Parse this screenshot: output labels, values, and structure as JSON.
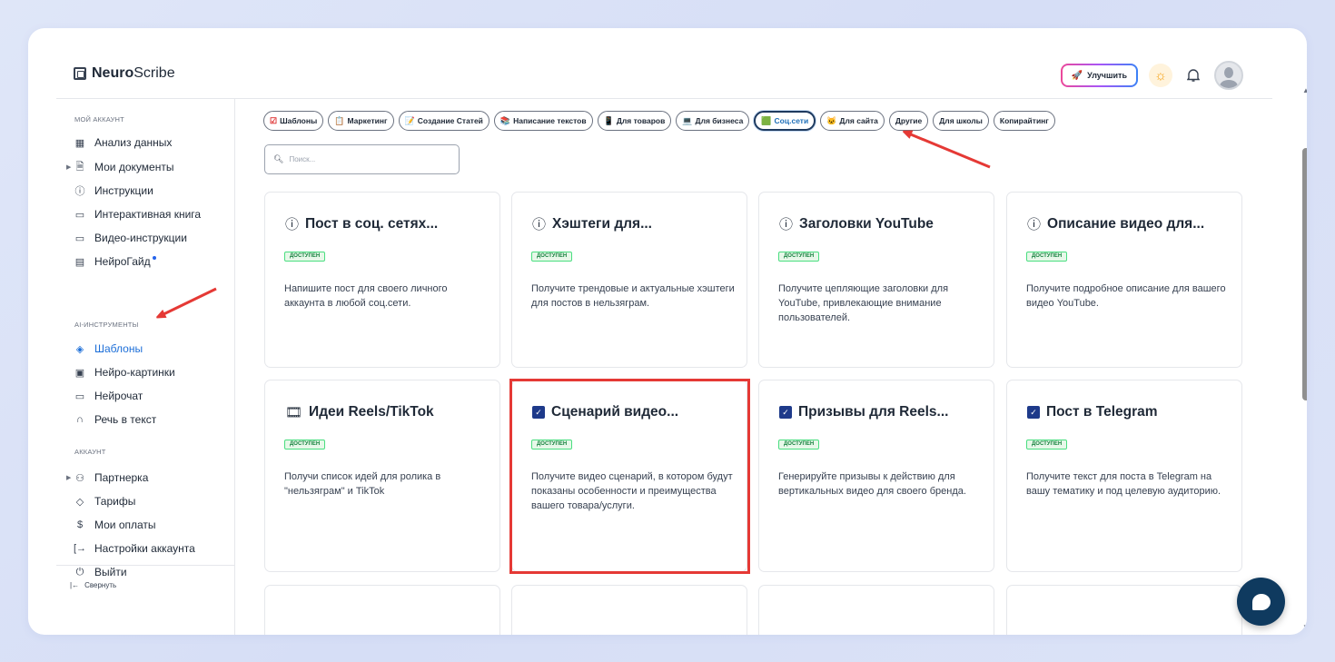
{
  "logo": {
    "bold": "Neuro",
    "rest": "Scribe"
  },
  "header": {
    "upgrade_label": "Улучшить"
  },
  "sidebar": {
    "sections": [
      {
        "title": "МОЙ АККАУНТ"
      },
      {
        "title": "AI-ИНСТРУМЕНТЫ"
      },
      {
        "title": "АККАУНТ"
      }
    ],
    "items": [
      {
        "label": "Анализ данных",
        "icon": "grid-icon"
      },
      {
        "label": "Мои документы",
        "icon": "document-icon"
      },
      {
        "label": "Инструкции",
        "icon": "help-icon"
      },
      {
        "label": "Интерактивная книга",
        "icon": "book-icon"
      },
      {
        "label": "Видео-инструкции",
        "icon": "video-icon"
      },
      {
        "label": "НейроГайд",
        "icon": "guide-icon"
      },
      {
        "label": "Шаблоны",
        "icon": "layers-icon"
      },
      {
        "label": "Нейро-картинки",
        "icon": "image-icon"
      },
      {
        "label": "Нейрочат",
        "icon": "chat-icon"
      },
      {
        "label": "Речь в текст",
        "icon": "headphones-icon"
      },
      {
        "label": "Партнерка",
        "icon": "users-icon"
      },
      {
        "label": "Тарифы",
        "icon": "tag-icon"
      },
      {
        "label": "Мои оплаты",
        "icon": "dollar-icon"
      },
      {
        "label": "Настройки аккаунта",
        "icon": "login-icon"
      },
      {
        "label": "Выйти",
        "icon": "power-icon"
      }
    ],
    "collapse_label": "Свернуть"
  },
  "categories": [
    {
      "label": "Шаблоны",
      "icon": "☑"
    },
    {
      "label": "Маркетинг",
      "icon": "📋"
    },
    {
      "label": "Создание Статей",
      "icon": "📝"
    },
    {
      "label": "Написание текстов",
      "icon": "📚"
    },
    {
      "label": "Для товаров",
      "icon": "📱"
    },
    {
      "label": "Для бизнеса",
      "icon": "💻"
    },
    {
      "label": "Соц.сети",
      "icon": "🟩"
    },
    {
      "label": "Для сайта",
      "icon": "🐱"
    },
    {
      "label": "Другие",
      "icon": ""
    },
    {
      "label": "Для школы",
      "icon": ""
    },
    {
      "label": "Копирайтинг",
      "icon": ""
    }
  ],
  "active_category": "Соц.сети",
  "search": {
    "placeholder": "Поиск..."
  },
  "cards": [
    {
      "title": "Пост в соц. сетях...",
      "badge": "ДОСТУПЕН",
      "desc": "Напишите пост для своего личного аккаунта в любой соц.сети.",
      "icon": "info-icon"
    },
    {
      "title": "Хэштеги для...",
      "badge": "ДОСТУПЕН",
      "desc": "Получите трендовые и актуальные хэштеги для постов в нельзяграм.",
      "icon": "info-icon"
    },
    {
      "title": "Заголовки YouTube",
      "badge": "ДОСТУПЕН",
      "desc": "Получите цепляющие заголовки для YouTube, привлекающие внимание пользователей.",
      "icon": "info-icon"
    },
    {
      "title": "Описание видео для...",
      "badge": "ДОСТУПЕН",
      "desc": "Получите подробное описание для вашего видео YouTube.",
      "icon": "info-icon"
    },
    {
      "title": "Идеи Reels/TikTok",
      "badge": "ДОСТУПЕН",
      "desc": "Получи список идей для ролика в \"нельзяграм\" и TikTok",
      "icon": "film-icon"
    },
    {
      "title": "Сценарий видео...",
      "badge": "ДОСТУПЕН",
      "desc": "Получите видео сценарий, в котором будут показаны особенности и преимущества вашего товара/услуги.",
      "icon": "checkbox-icon"
    },
    {
      "title": "Призывы для Reels...",
      "badge": "ДОСТУПЕН",
      "desc": "Генерируйте призывы к действию для вертикальных видео для своего бренда.",
      "icon": "checkbox-icon"
    },
    {
      "title": "Пост в Telegram",
      "badge": "ДОСТУПЕН",
      "desc": "Получите текст для поста в Telegram на вашу тематику и под целевую аудиторию.",
      "icon": "checkbox-icon"
    }
  ],
  "colors": {
    "accent": "#1d6fd8",
    "highlight": "#e53935",
    "chat_button": "#0f3a5f",
    "badge_green": "#15803d"
  }
}
